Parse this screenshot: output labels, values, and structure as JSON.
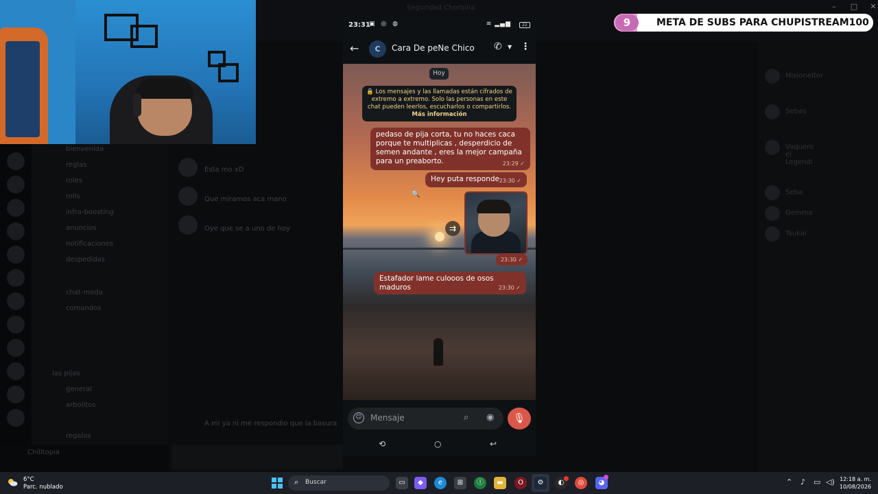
{
  "window": {
    "title": "Seguridad Chorbina"
  },
  "discord": {
    "channels": [
      "bienvenida",
      "reglas",
      "roles",
      "rolls",
      "infra-boosting",
      "anuncios",
      "notificaciones",
      "despedidas",
      "chat-moda",
      "comandos",
      "las pijas",
      "general",
      "arbolitos",
      "regalos"
    ],
    "chat_lines": [
      "Esta mo xD",
      "Que miramos aca mano",
      "Oye que se a uno de hoy",
      "A mi ya ni me respondio que la basura"
    ],
    "self_name": "Chilltopia",
    "members": [
      "Misioneitor",
      "Sebas",
      "Vaquero el Legendi",
      "Seba",
      "Gemma",
      "Tsukai"
    ]
  },
  "goal": {
    "number": "9",
    "label": "META DE SUBS PARA CHUPISTREAM100",
    "progress": 0.09
  },
  "phone": {
    "status_time": "23:31",
    "battery": "22",
    "contact_avatar": "C",
    "contact_name": "Cara De peNe Chico",
    "date_chip": "Hoy",
    "encryption_notice": "🔒 Los mensajes y las llamadas están cifrados de extremo a extremo. Solo las personas en este chat pueden leerlos, escucharlos o compartirlos.",
    "more_info": "Más información",
    "messages": [
      {
        "text": "pedaso de pija corta, tu no haces caca porque te multiplicas , desperdicio de semen andante , eres la mejor campaña para un preaborto.",
        "time": "23:29 ✓"
      },
      {
        "text": "Hey puta responde",
        "time": "23:30 ✓"
      },
      {
        "image": "photo-message",
        "time": "23:30 ✓"
      },
      {
        "text": "Estafador lame culooos de osos maduros",
        "time": "23:30 ✓"
      }
    ],
    "compose_placeholder": "Mensaje"
  },
  "taskbar": {
    "weather_temp": "6°C",
    "weather_desc": "Parc. nublado",
    "search_label": "Buscar",
    "clock_time": "12:18 a. m.",
    "clock_date": "10/08/2026"
  }
}
